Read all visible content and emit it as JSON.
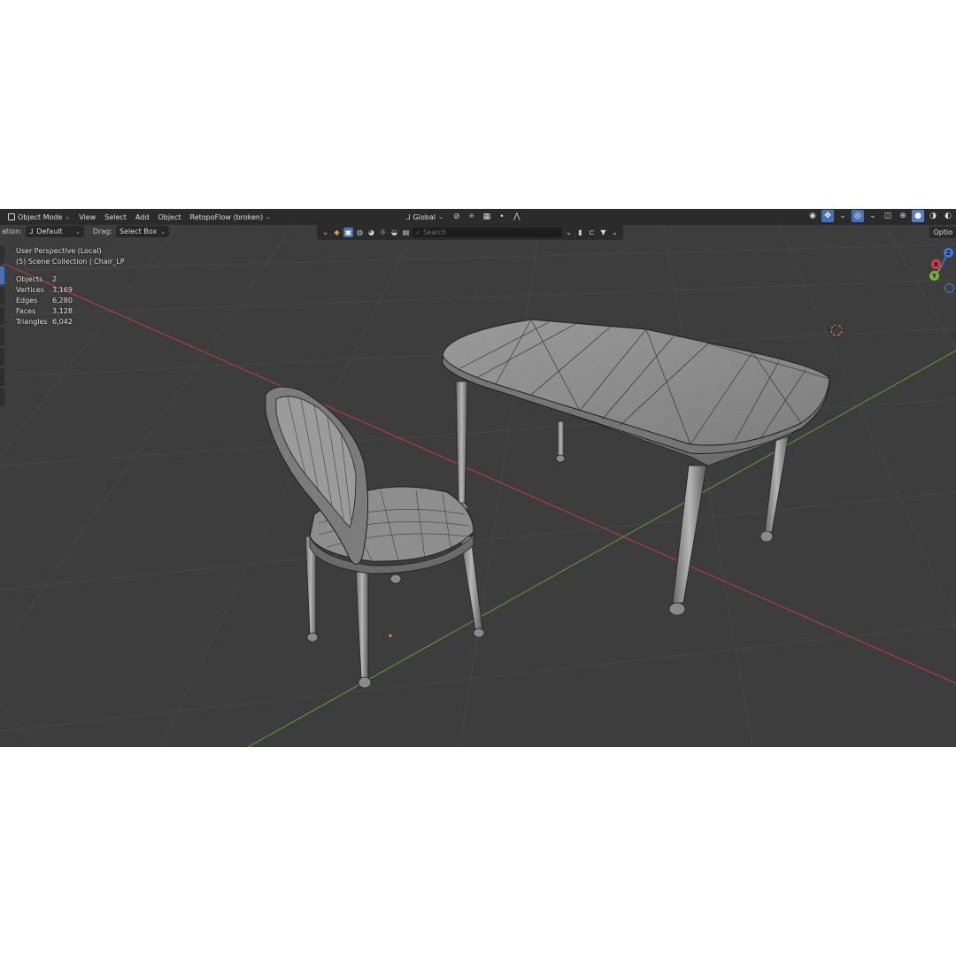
{
  "header": {
    "mode": "Object Mode",
    "menus": [
      "View",
      "Select",
      "Add",
      "Object",
      "RetopoFlow (broken)"
    ],
    "transform_orientation": "Global"
  },
  "tool_settings": {
    "orientation_label": "ation:",
    "orientation_value": "Default",
    "drag_label": "Drag:",
    "drag_value": "Select Box"
  },
  "outliner_filter": {
    "search_placeholder": "Search"
  },
  "options_label": "Optio",
  "viewport": {
    "perspective": "User Perspective (Local)",
    "collection": "(5) Scene Collection | Chair_LP",
    "stats": [
      {
        "label": "Objects",
        "value": "2"
      },
      {
        "label": "Vertices",
        "value": "3,169"
      },
      {
        "label": "Edges",
        "value": "6,280"
      },
      {
        "label": "Faces",
        "value": "3,128"
      },
      {
        "label": "Triangles",
        "value": "6,042"
      }
    ]
  },
  "gizmo": {
    "z": "Z",
    "x": "X",
    "y": "Y"
  },
  "colors": {
    "viewport_bg": "#3d3d3d",
    "header_bg": "#2b2b2b",
    "accent": "#4772b3",
    "x_axis": "#c83a45",
    "y_axis": "#6c9a2a",
    "mesh": "#8a8a8a"
  }
}
